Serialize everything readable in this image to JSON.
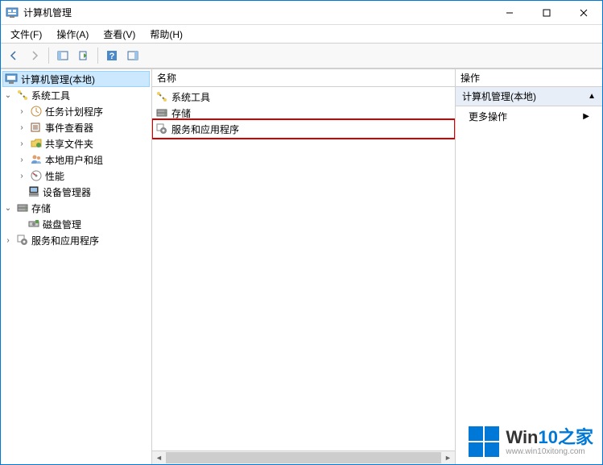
{
  "window": {
    "title": "计算机管理"
  },
  "menu": {
    "file": "文件(F)",
    "action": "操作(A)",
    "view": "查看(V)",
    "help": "帮助(H)"
  },
  "tree": {
    "root": "计算机管理(本地)",
    "system_tools": "系统工具",
    "task_scheduler": "任务计划程序",
    "event_viewer": "事件查看器",
    "shared_folders": "共享文件夹",
    "local_users": "本地用户和组",
    "performance": "性能",
    "device_manager": "设备管理器",
    "storage": "存储",
    "disk_management": "磁盘管理",
    "services_apps": "服务和应用程序"
  },
  "list": {
    "header_name": "名称",
    "items": {
      "system_tools": "系统工具",
      "storage": "存储",
      "services_apps": "服务和应用程序"
    }
  },
  "actions": {
    "header": "操作",
    "group": "计算机管理(本地)",
    "more": "更多操作"
  },
  "watermark": {
    "brand1": "Win",
    "brand2": "10",
    "suffix": "之家",
    "url": "www.win10xitong.com"
  }
}
